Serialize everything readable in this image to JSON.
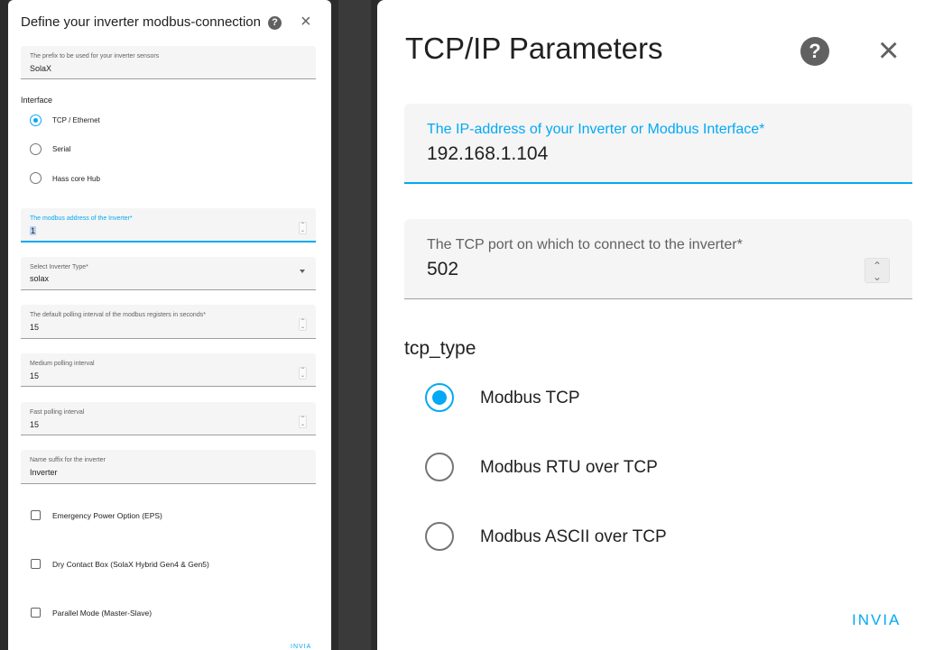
{
  "left_dialog": {
    "title": "Define your inverter modbus-connection",
    "help_glyph": "?",
    "close_glyph": "×",
    "prefix_field": {
      "label": "The prefix to be used for your inverter sensors",
      "value": "SolaX"
    },
    "interface": {
      "label": "Interface",
      "options": [
        "TCP / Ethernet",
        "Serial",
        "Hass core Hub"
      ],
      "selected": "TCP / Ethernet"
    },
    "modbus_address_field": {
      "label": "The modbus address of the Inverter*",
      "value": "1"
    },
    "inverter_type_field": {
      "label": "Select Inverter Type*",
      "value": "solax"
    },
    "polling_field": {
      "label": "The default polling interval of the modbus registers in seconds*",
      "value": "15"
    },
    "medium_polling_field": {
      "label": "Medium polling interval",
      "value": "15"
    },
    "fast_polling_field": {
      "label": "Fast polling interval",
      "value": "15"
    },
    "name_suffix_field": {
      "label": "Name suffix for the inverter",
      "value": "Inverter"
    },
    "checkboxes": [
      "Emergency Power Option (EPS)",
      "Dry Contact Box (SolaX Hybrid Gen4 & Gen5)",
      "Parallel Mode (Master-Slave)"
    ],
    "submit_label": "INVIA"
  },
  "right_dialog": {
    "title": "TCP/IP Parameters",
    "help_glyph": "?",
    "close_glyph": "×",
    "ip_field": {
      "label": "The IP-address of your Inverter or Modbus Interface*",
      "value": "192.168.1.104"
    },
    "port_field": {
      "label": "The TCP port on which to connect to the inverter*",
      "value": "502"
    },
    "tcp_type": {
      "label": "tcp_type",
      "options": [
        "Modbus TCP",
        "Modbus RTU over TCP",
        "Modbus ASCII over TCP"
      ],
      "selected": "Modbus TCP"
    },
    "submit_label": "INVIA"
  },
  "colors": {
    "accent": "#03a9f4",
    "field_bg": "#f5f5f5",
    "text": "#212121",
    "icon": "#616161"
  },
  "icons": {
    "help": "help-circle-icon",
    "close": "close-icon",
    "stepper": "spin-stepper-icon",
    "dropdown": "caret-down-icon"
  }
}
